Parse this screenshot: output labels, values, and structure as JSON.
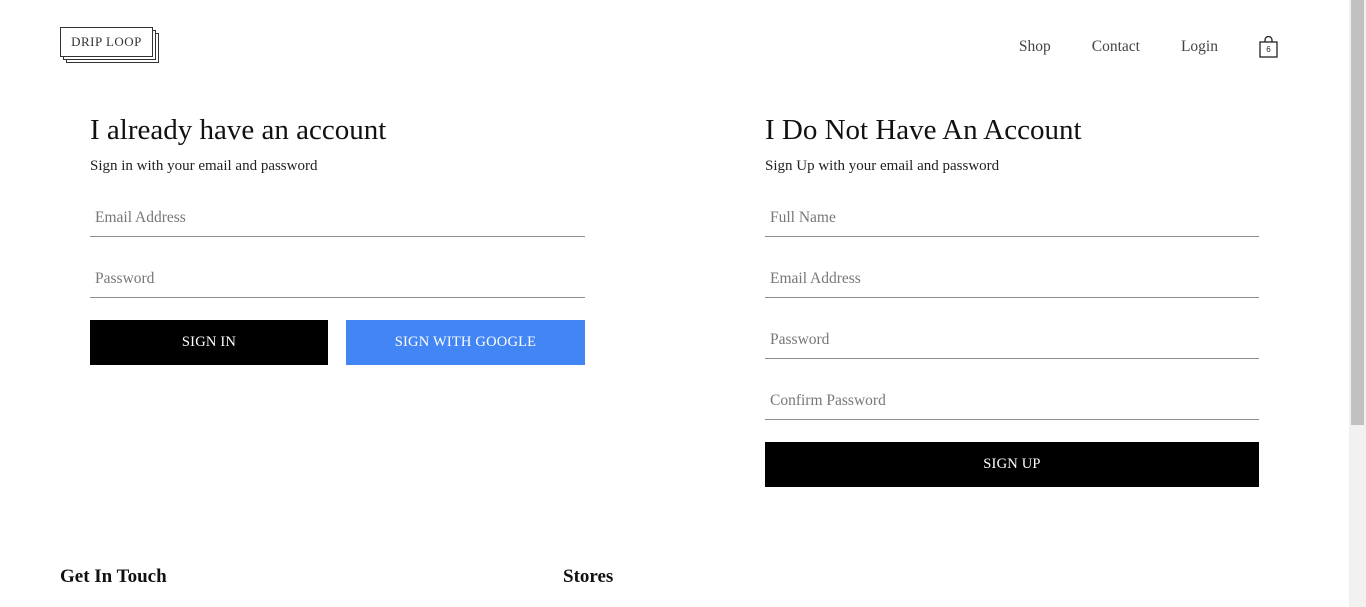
{
  "header": {
    "logo_text": "DRIP LOOP",
    "nav": [
      {
        "label": "Shop"
      },
      {
        "label": "Contact"
      },
      {
        "label": "Login"
      }
    ],
    "cart_count": "6",
    "cart_icon": "shopping-bag-icon"
  },
  "sign_in": {
    "title": "I already have an account",
    "subtitle": "Sign in with your email and password",
    "email_placeholder": "Email Address",
    "password_placeholder": "Password",
    "sign_in_label": "SIGN IN",
    "google_label": "SIGN WITH GOOGLE",
    "google_color": "#4285f4"
  },
  "sign_up": {
    "title": "I Do Not Have An Account",
    "subtitle": "Sign Up with your email and password",
    "name_placeholder": "Full Name",
    "email_placeholder": "Email Address",
    "password_placeholder": "Password",
    "confirm_placeholder": "Confirm Password",
    "sign_up_label": "SIGN UP"
  },
  "footer": {
    "get_in_touch": "Get In Touch",
    "stores": "Stores"
  }
}
